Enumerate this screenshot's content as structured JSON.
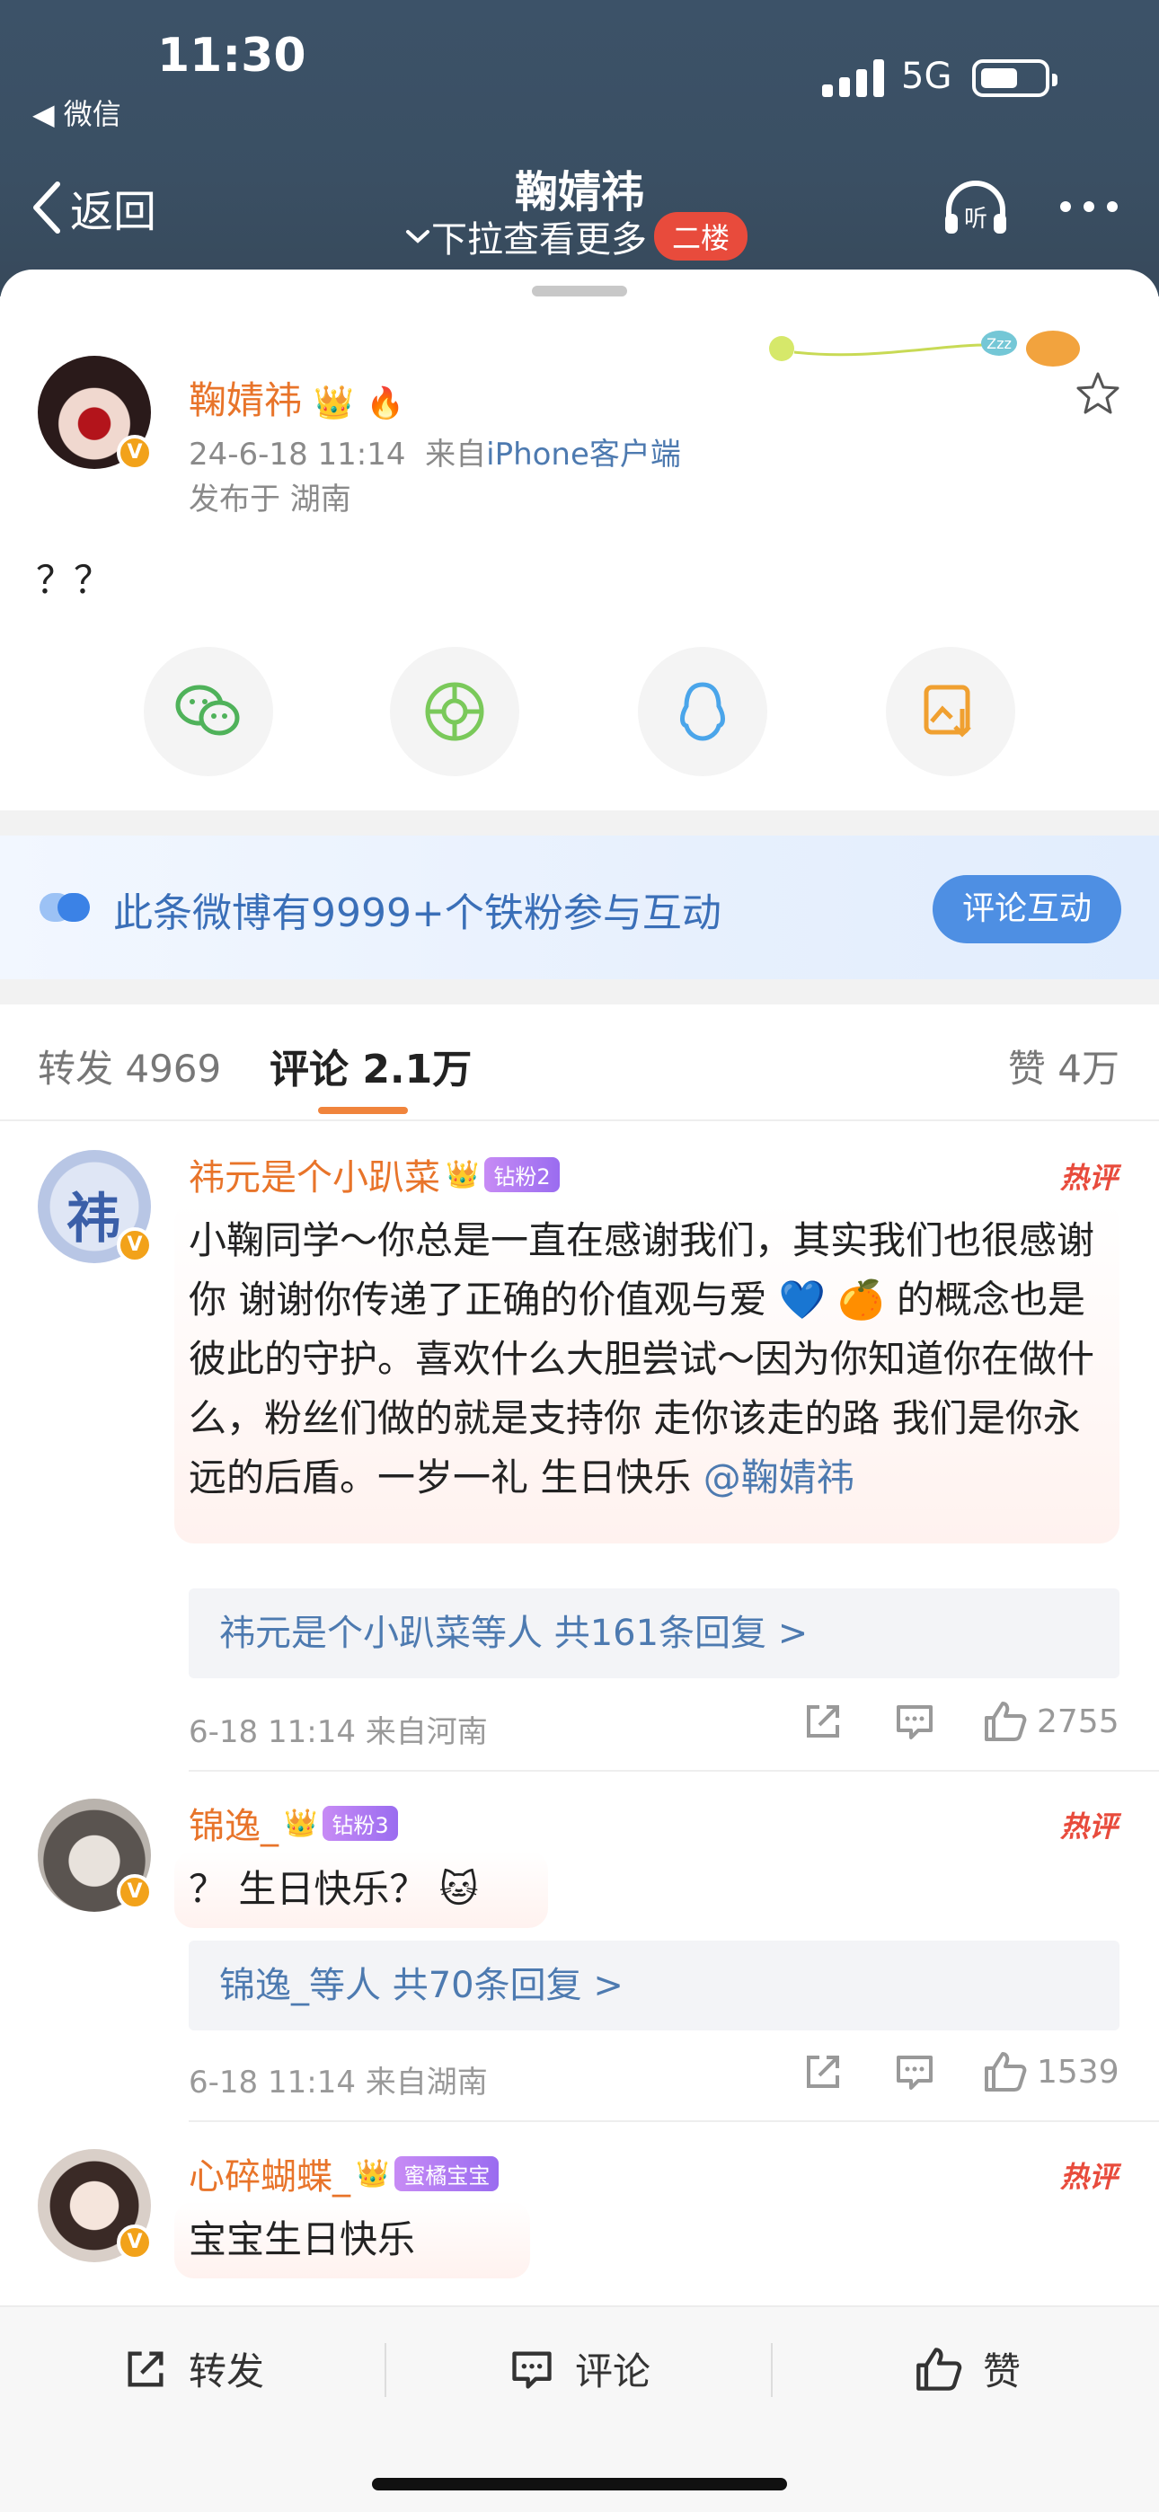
{
  "status_bar": {
    "time": "11:30",
    "back_app": "微信",
    "network": "5G"
  },
  "nav": {
    "back_label": "返回",
    "title": "鞠婧祎",
    "subtitle": "下拉查看更多",
    "floor_badge": "二楼",
    "listen_label": "听"
  },
  "post": {
    "author": "鞠婧祎",
    "date": "24-6-18 11:14",
    "source_prefix": "来自",
    "source": "iPhone客户端",
    "location": "发布于 湖南",
    "text": "？？"
  },
  "fan_banner": {
    "text": "此条微博有9999+个铁粉参与互动",
    "button": "评论互动"
  },
  "tabs": {
    "repost": "转发 4969",
    "comment": "评论 2.1万",
    "like": "赞 4万"
  },
  "comments": [
    {
      "name": "祎元是个小趴菜",
      "level": "钻粉2",
      "hot": "热评",
      "text": "小鞠同学～你总是一直在感谢我们，其实我们也很感谢你 谢谢你传递了正确的价值观与爱 💙 🍊 的概念也是彼此的守护。喜欢什么大胆尝试～因为你知道你在做什么，粉丝们做的就是支持你 走你该走的路 我们是你永远的后盾。一岁一礼 生日快乐 ",
      "mention": "@鞠婧祎",
      "reply": "祎元是个小趴菜等人  共161条回复 >",
      "meta": "6-18 11:14  来自河南",
      "likes": "2755"
    },
    {
      "name": "锦逸_",
      "level": "钻粉3",
      "hot": "热评",
      "text": "？ 生日快乐？",
      "reply": "锦逸_等人  共70条回复 >",
      "meta": "6-18 11:14  来自湖南",
      "likes": "1539"
    },
    {
      "name": "心碎蝴蝶_",
      "level": "蜜橘宝宝",
      "hot": "热评",
      "text": "宝宝生日快乐"
    }
  ],
  "bottom_bar": {
    "repost": "转发",
    "comment": "评论",
    "like": "赞"
  },
  "colors": {
    "header": "#3a4f63",
    "username": "#e8742a",
    "link": "#4d7ab0",
    "hot": "#e84b3c",
    "accent": "#f0843c"
  }
}
